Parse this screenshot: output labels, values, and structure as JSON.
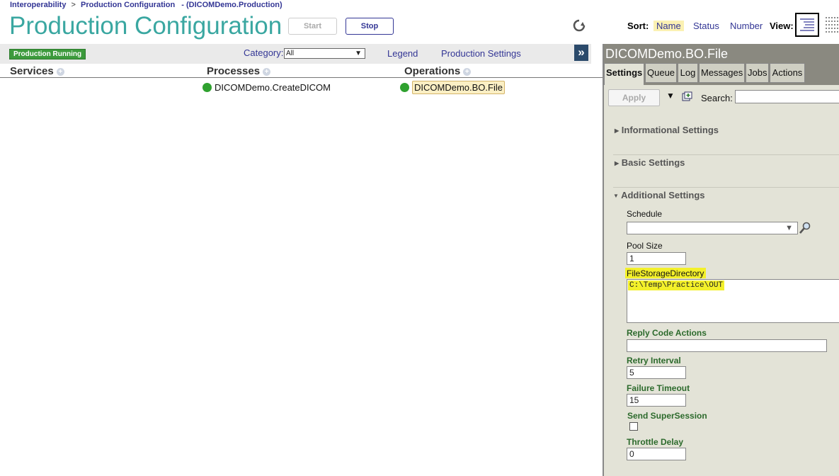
{
  "breadcrumb": {
    "root": "Interoperability",
    "separator": ">",
    "page": "Production Configuration",
    "context": "- (DICOMDemo.Production)"
  },
  "page_title": "Production Configuration",
  "toolbar": {
    "start_label": "Start",
    "stop_label": "Stop"
  },
  "sort": {
    "label": "Sort:",
    "options": [
      "Name",
      "Status",
      "Number"
    ],
    "selected": "Name"
  },
  "view": {
    "label": "View:"
  },
  "status_badge": "Production Running",
  "category": {
    "label": "Category:",
    "value": "All"
  },
  "links": {
    "legend": "Legend",
    "production_settings": "Production Settings"
  },
  "columns": {
    "services": "Services",
    "processes": "Processes",
    "operations": "Operations"
  },
  "items": {
    "process": "DICOMDemo.CreateDICOM",
    "operation": "DICOMDemo.BO.File"
  },
  "panel": {
    "title": "DICOMDemo.BO.File",
    "tabs": [
      "Settings",
      "Queue",
      "Log",
      "Messages",
      "Jobs",
      "Actions"
    ],
    "active_tab": "Settings",
    "apply_label": "Apply",
    "search_label": "Search:",
    "sections": {
      "informational": "Informational Settings",
      "basic": "Basic Settings",
      "additional": "Additional Settings"
    },
    "fields": {
      "schedule": {
        "label": "Schedule",
        "value": ""
      },
      "pool_size": {
        "label": "Pool Size",
        "value": "1"
      },
      "file_storage": {
        "label": "FileStorageDirectory",
        "value": "C:\\Temp\\Practice\\OUT"
      },
      "reply_code": {
        "label": "Reply Code Actions",
        "value": ""
      },
      "retry_interval": {
        "label": "Retry Interval",
        "value": "5"
      },
      "failure_timeout": {
        "label": "Failure Timeout",
        "value": "15"
      },
      "send_supersession": {
        "label": "Send SuperSession"
      },
      "throttle_delay": {
        "label": "Throttle Delay",
        "value": "0"
      }
    }
  },
  "colors": {
    "title": "#3aa7a1",
    "link": "#333695",
    "running": "#3c9a3c",
    "highlight": "#f3f02a"
  }
}
